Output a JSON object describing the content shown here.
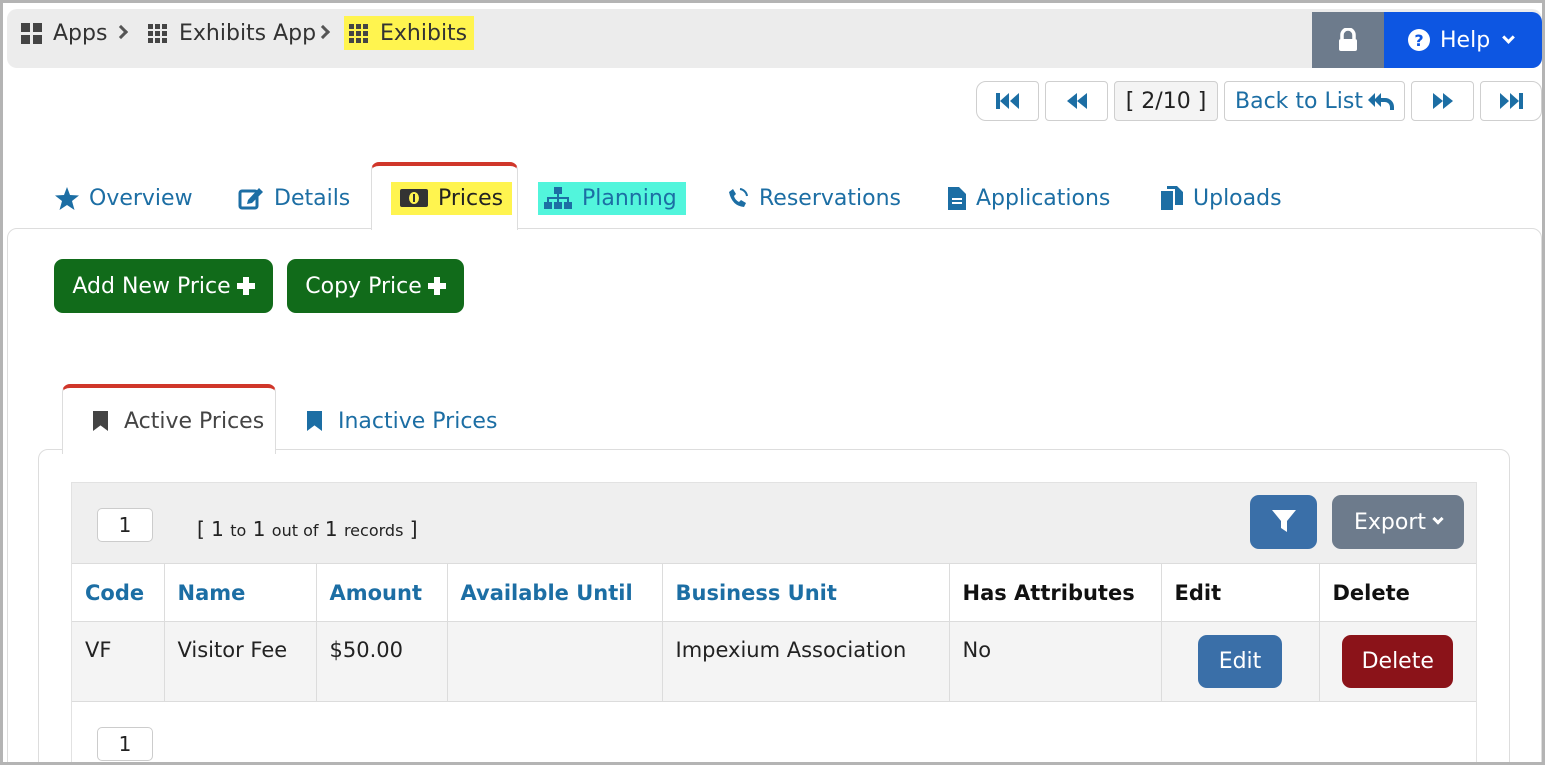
{
  "breadcrumb": {
    "items": [
      {
        "label": "Apps",
        "icon": "grid-2x2-icon"
      },
      {
        "label": "Exhibits App",
        "icon": "grid-3x3-icon"
      },
      {
        "label": "Exhibits",
        "icon": "grid-3x3-icon",
        "highlighted": true
      }
    ]
  },
  "header": {
    "lock_icon": "lock-icon",
    "help_label": "Help"
  },
  "pager": {
    "position": "[ 2/10 ]",
    "back_label": "Back to List"
  },
  "tabs": [
    {
      "label": "Overview",
      "icon": "star-icon"
    },
    {
      "label": "Details",
      "icon": "edit-icon"
    },
    {
      "label": "Prices",
      "icon": "money-icon",
      "active": true
    },
    {
      "label": "Planning",
      "icon": "sitemap-icon"
    },
    {
      "label": "Reservations",
      "icon": "phone-icon"
    },
    {
      "label": "Applications",
      "icon": "document-icon"
    },
    {
      "label": "Uploads",
      "icon": "copy-icon"
    }
  ],
  "actions": {
    "add_new_price": "Add New Price",
    "copy_price": "Copy Price"
  },
  "subtabs": {
    "active": "Active Prices",
    "inactive": "Inactive Prices"
  },
  "grid": {
    "page": "1",
    "records": {
      "open": "[",
      "from": "1",
      "to_word": "to",
      "to": "1",
      "out_of_word": "out of",
      "total": "1",
      "records_word": "records",
      "close": "]"
    },
    "export_label": "Export",
    "columns": [
      "Code",
      "Name",
      "Amount",
      "Available Until",
      "Business Unit",
      "Has Attributes",
      "Edit",
      "Delete"
    ],
    "rows": [
      {
        "code": "VF",
        "name": "Visitor Fee",
        "amount": "$50.00",
        "available_until": "",
        "business_unit": "Impexium Association",
        "has_attributes": "No",
        "edit": "Edit",
        "delete": "Delete"
      }
    ],
    "bottom_page": "1"
  },
  "colors": {
    "link_blue": "#1c6ea4",
    "help_blue": "#0d56e2",
    "green": "#116b1a",
    "delete_red": "#8b1319",
    "highlight_yellow": "#fff44f",
    "highlight_cyan": "#52f5dc",
    "tab_accent": "#d0362a"
  }
}
